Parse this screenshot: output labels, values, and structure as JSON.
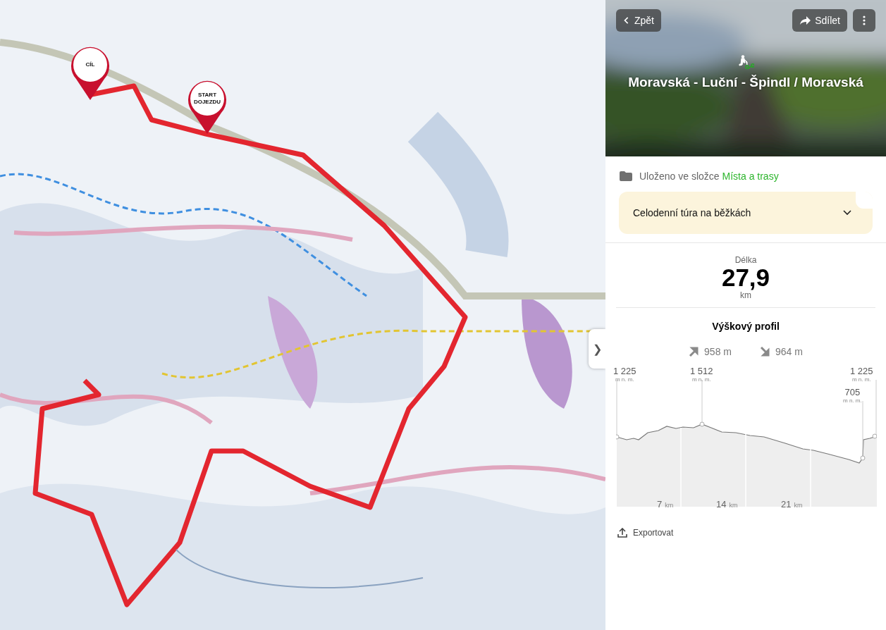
{
  "map": {
    "pins": [
      {
        "label": "CÍL"
      },
      {
        "label": "START DOJEZDU"
      }
    ],
    "expand_button": "❯"
  },
  "panel": {
    "header": {
      "back": "Zpět",
      "share": "Sdílet",
      "title": "Moravská - Luční - Špindl / Moravská"
    },
    "folder": {
      "prefix": "Uloženo ve složce",
      "link": "Místa a trasy"
    },
    "note": {
      "text": "Celodenní túra na běžkách",
      "expanded": false
    },
    "length": {
      "label": "Délka",
      "value": "27,9",
      "unit": "km"
    },
    "profile": {
      "title": "Výškový profil",
      "ascent": "958 m",
      "descent": "964 m",
      "points": [
        {
          "value": "1 225",
          "unit": "m n. m."
        },
        {
          "value": "1 512",
          "unit": "m n. m."
        },
        {
          "value": "1 225",
          "unit": "m n. m."
        },
        {
          "value": "705",
          "unit": "m n. m."
        }
      ],
      "xticks": [
        {
          "value": "7",
          "unit": "km"
        },
        {
          "value": "14",
          "unit": "km"
        },
        {
          "value": "21",
          "unit": "km"
        }
      ]
    },
    "export": "Exportovat"
  }
}
